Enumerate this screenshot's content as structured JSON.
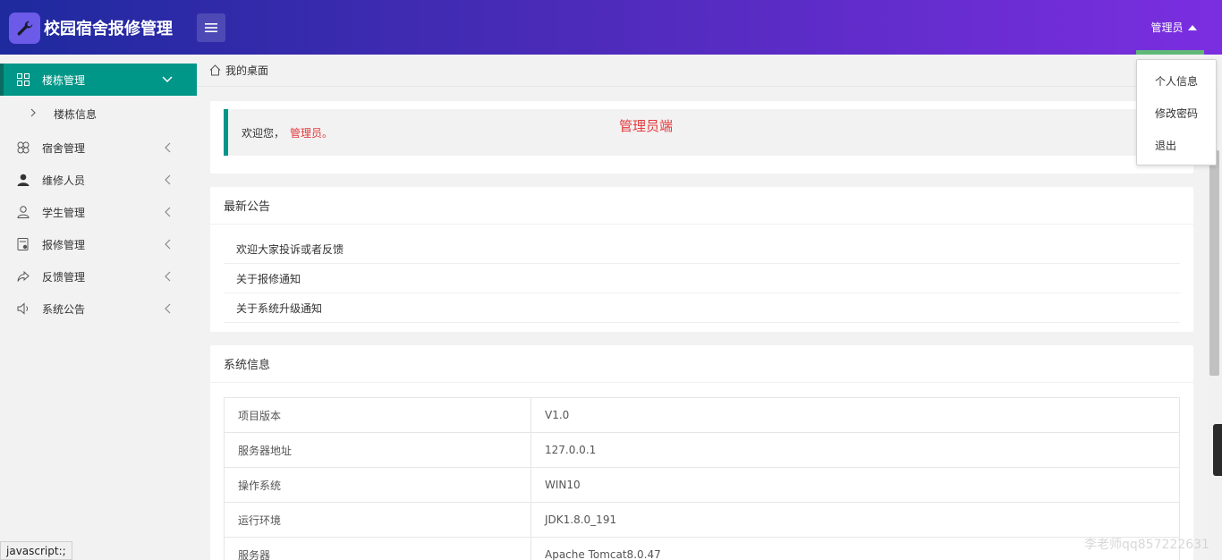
{
  "header": {
    "app_title": "校园宿舍报修管理",
    "user_name": "管理员"
  },
  "sidebar": {
    "items": [
      {
        "label": "楼栋管理",
        "icon": "grid-icon"
      },
      {
        "label": "宿舍管理",
        "icon": "clover-icon"
      },
      {
        "label": "维修人员",
        "icon": "person-filled-icon"
      },
      {
        "label": "学生管理",
        "icon": "user-outline-icon"
      },
      {
        "label": "报修管理",
        "icon": "report-icon"
      },
      {
        "label": "反馈管理",
        "icon": "share-icon"
      },
      {
        "label": "系统公告",
        "icon": "speaker-icon"
      }
    ],
    "sub_item": "楼栋信息"
  },
  "breadcrumb": {
    "label": "我的桌面"
  },
  "welcome": {
    "greeting": "欢迎您，",
    "user": "管理员。",
    "role_label": "管理员端"
  },
  "notice": {
    "title": "最新公告",
    "items": [
      "欢迎大家投诉或者反馈",
      "关于报修通知",
      "关于系统升级通知"
    ]
  },
  "sysinfo": {
    "title": "系统信息",
    "rows": [
      {
        "key": "项目版本",
        "value": "V1.0"
      },
      {
        "key": "服务器地址",
        "value": "127.0.0.1"
      },
      {
        "key": "操作系统",
        "value": "WIN10"
      },
      {
        "key": "运行环境",
        "value": "JDK1.8.0_191"
      },
      {
        "key": "服务器",
        "value": "Apache Tomcat8.0.47"
      }
    ]
  },
  "dropdown": {
    "items": [
      "个人信息",
      "修改密码",
      "退出"
    ]
  },
  "status_bar": "javascript:;",
  "watermark": "李老师qq857222631",
  "colors": {
    "accent": "#009688",
    "header_start": "#1e2a9e",
    "header_end": "#7b2ee0",
    "highlight": "#e4393c"
  }
}
